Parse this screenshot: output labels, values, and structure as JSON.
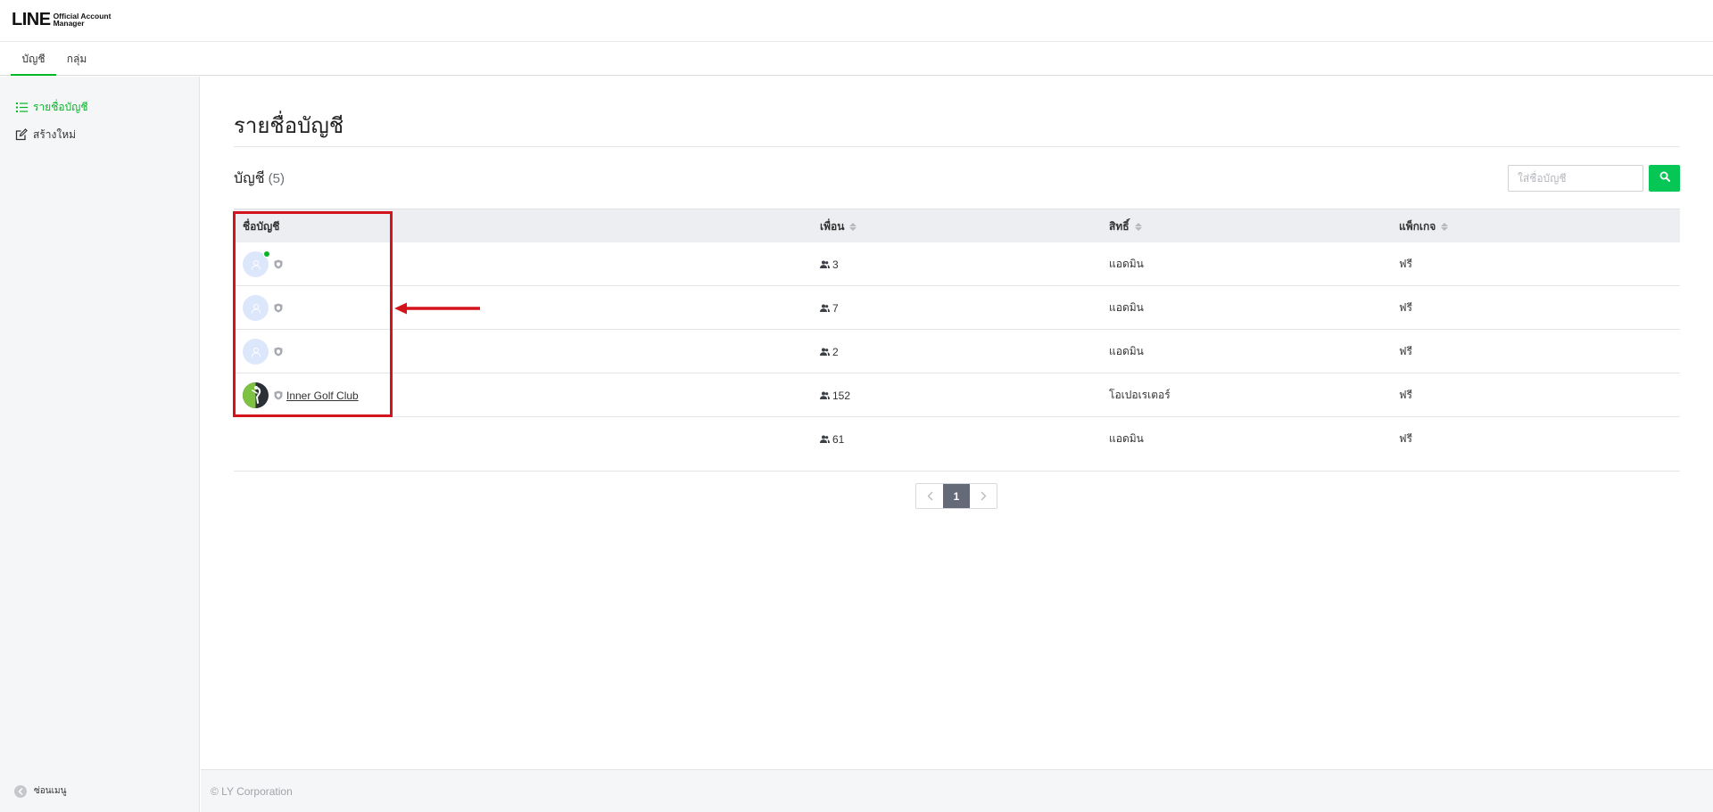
{
  "header": {
    "logo_main": "LINE",
    "logo_sub_line1": "Official Account",
    "logo_sub_line2": "Manager"
  },
  "tabs": [
    {
      "label": "บัญชี",
      "active": true
    },
    {
      "label": "กลุ่ม",
      "active": false
    }
  ],
  "sidebar": {
    "items": [
      {
        "label": "รายชื่อบัญชี",
        "icon": "list-icon",
        "active": true
      },
      {
        "label": "สร้างใหม่",
        "icon": "edit-icon",
        "active": false
      }
    ],
    "collapse_label": "ซ่อนเมนู"
  },
  "main": {
    "page_title": "รายชื่อบัญชี",
    "section_title": "บัญชี",
    "section_count": "(5)",
    "search": {
      "placeholder": "ใส่ชื่อบัญชี",
      "value": ""
    },
    "table": {
      "columns": [
        "ชื่อบัญชี",
        "เพื่อน",
        "สิทธิ์",
        "แพ็กเกจ"
      ],
      "rows": [
        {
          "name": "",
          "friends": "3",
          "role": "แอดมิน",
          "package": "ฟรี",
          "online": true,
          "avatar": "default"
        },
        {
          "name": "",
          "friends": "7",
          "role": "แอดมิน",
          "package": "ฟรี",
          "online": false,
          "avatar": "default"
        },
        {
          "name": "",
          "friends": "2",
          "role": "แอดมิน",
          "package": "ฟรี",
          "online": false,
          "avatar": "default"
        },
        {
          "name": "Inner Golf Club",
          "friends": "152",
          "role": "โอเปอเรเตอร์",
          "package": "ฟรี",
          "online": false,
          "avatar": "golf"
        },
        {
          "name": "",
          "friends": "61",
          "role": "แอดมิน",
          "package": "ฟรี",
          "online": false,
          "avatar": "none"
        }
      ]
    },
    "pagination": {
      "current": "1"
    }
  },
  "footer": {
    "copyright": "© LY Corporation"
  },
  "colors": {
    "brand_green": "#06c755",
    "active_green": "#06b627",
    "annotation_red": "#d4141c"
  }
}
